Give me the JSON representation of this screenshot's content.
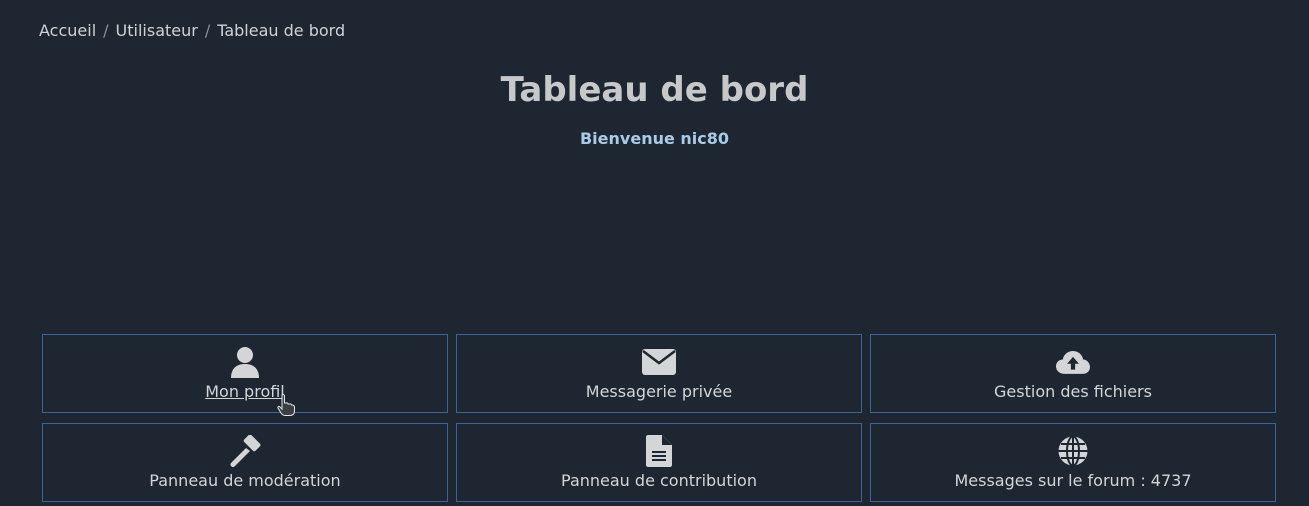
{
  "breadcrumb": {
    "items": [
      "Accueil",
      "Utilisateur",
      "Tableau de bord"
    ],
    "separator": "/"
  },
  "header": {
    "title": "Tableau de bord",
    "welcome": "Bienvenue nic80"
  },
  "tiles": [
    {
      "label": "Mon profil",
      "icon": "user-icon"
    },
    {
      "label": "Messagerie privée",
      "icon": "envelope-icon"
    },
    {
      "label": "Gestion des fichiers",
      "icon": "cloud-upload-icon"
    },
    {
      "label": "Panneau de modération",
      "icon": "gavel-icon"
    },
    {
      "label": "Panneau de contribution",
      "icon": "document-icon"
    },
    {
      "label": "Messages sur le forum : 4737",
      "icon": "globe-icon"
    }
  ],
  "colors": {
    "background": "#1e2631",
    "tile_border": "#3d6494",
    "welcome": "#a9cbe8",
    "title": "#c6c8ca"
  }
}
